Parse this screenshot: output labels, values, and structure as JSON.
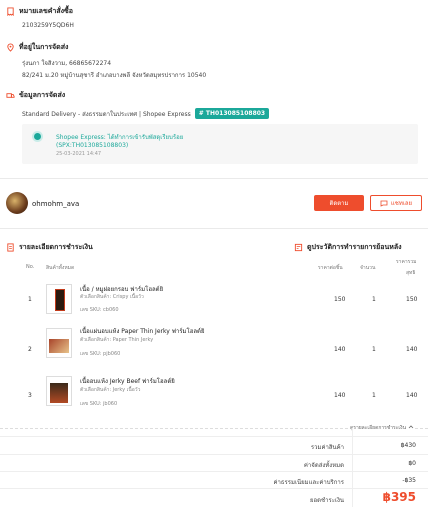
{
  "order": {
    "heading": "หมายเลขคำสั่งซื้อ",
    "number": "2103259Y5QD6H"
  },
  "address": {
    "heading": "ที่อยู่ในการจัดส่ง",
    "name_phone": "รุ่งนภา ใจสิงวาม, 66865672274",
    "line": "82/241 ม.20 หมู่บ้านสุชารี อำเภอบางพลี จังหวัดสมุทรปราการ 10540"
  },
  "shipping": {
    "heading": "ข้อมูลการจัดส่ง",
    "method": "Standard Delivery - ส่งธรรมดาในประเทศ | Shopee Express",
    "tracking_tag": "# TH013085108803",
    "status": "Shopee Express: ได้ทำการเข้ารับพัสดุเรียบร้อย",
    "status_code": "(SPX:TH013085108803)",
    "status_time": "25-03-2021 14:47"
  },
  "seller": {
    "name": "ohmohm_ava",
    "chat_label": "ติดตาม",
    "contact_label": "แชทเลย"
  },
  "items_section": {
    "heading": "รายละเอียดการชำระเงิน",
    "return_heading": "ดูประวัติการทำรายการย้อนหลัง",
    "columns": {
      "no": "No.",
      "product": "สินค้าทั้งหมด",
      "unit_price": "ราคาต่อชิ้น",
      "qty": "จำนวน",
      "subtotal_top": "ราคารวม",
      "subtotal_bottom": "สุทธิ"
    },
    "rows": [
      {
        "no": "1",
        "name": "เนื้อ / หมูฝอยกรอบ ฟาร์มโฮลต์ยิ",
        "variant": "ตัวเลือกสินค้า: Crispy เนื้อวัว",
        "sku": "เลข SKU: cb060",
        "price": "150",
        "qty": "1",
        "total": "150"
      },
      {
        "no": "2",
        "name": "เนื้อแผ่นอบแห้ง Paper Thin Jerky ฟาร์มโฮลต์ยิ",
        "variant": "ตัวเลือกสินค้า: Paper Thin Jerky",
        "sku": "เลข SKU: pjb060",
        "price": "140",
        "qty": "1",
        "total": "140"
      },
      {
        "no": "3",
        "name": "เนื้ออบแห้ง Jerky Beef ฟาร์มโฮลต์ยิ",
        "variant": "ตัวเลือกสินค้า: Jerky เนื้อวัว",
        "sku": "เลข SKU: jb060",
        "price": "140",
        "qty": "1",
        "total": "140"
      }
    ]
  },
  "summary": {
    "toggle": "ดูรายละเอียดการชำระเงิน",
    "rows": [
      {
        "label": "รวมค่าสินค้า",
        "value": "฿430"
      },
      {
        "label": "ค่าจัดส่งทั้งหมด",
        "value": "฿0"
      },
      {
        "label": "ค่าธรรมเนียมและค่าบริการ",
        "value": "-฿35"
      }
    ],
    "total_label": "ยอดชำระเงิน",
    "total_value": "฿395"
  },
  "colors": {
    "accent": "#ee4d2d",
    "teal": "#1ba89a"
  }
}
